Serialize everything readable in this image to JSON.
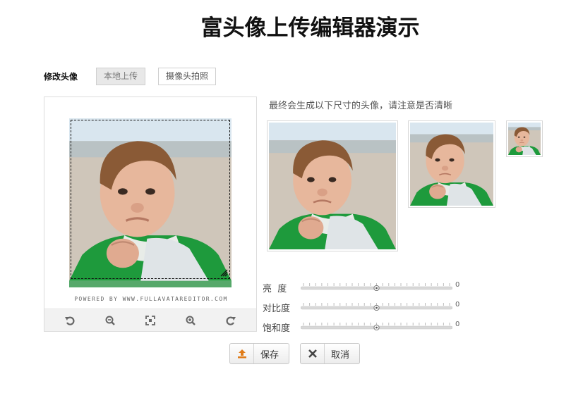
{
  "page": {
    "title": "富头像上传编辑器演示"
  },
  "tabs": {
    "label": "修改头像",
    "items": [
      {
        "label": "本地上传",
        "active": true
      },
      {
        "label": "摄像头拍照",
        "active": false
      }
    ]
  },
  "editor": {
    "powered_by": "POWERED BY WWW.FULLAVATAREDITOR.COM",
    "tools": [
      "rotate-left-icon",
      "zoom-out-icon",
      "fit-icon",
      "zoom-in-icon",
      "rotate-right-icon"
    ]
  },
  "preview": {
    "hint": "最终会生成以下尺寸的头像，请注意是否清晰"
  },
  "adjustments": {
    "brightness": {
      "label": "亮  度",
      "value": "0",
      "level": 0.5
    },
    "contrast": {
      "label": "对比度",
      "value": "0",
      "level": 0.5
    },
    "saturation": {
      "label": "饱和度",
      "value": "0",
      "level": 0.5
    }
  },
  "actions": {
    "save": {
      "label": "保存",
      "icon": "upload-icon",
      "icon_color": "#e07b18"
    },
    "cancel": {
      "label": "取消",
      "icon": "close-icon"
    }
  }
}
